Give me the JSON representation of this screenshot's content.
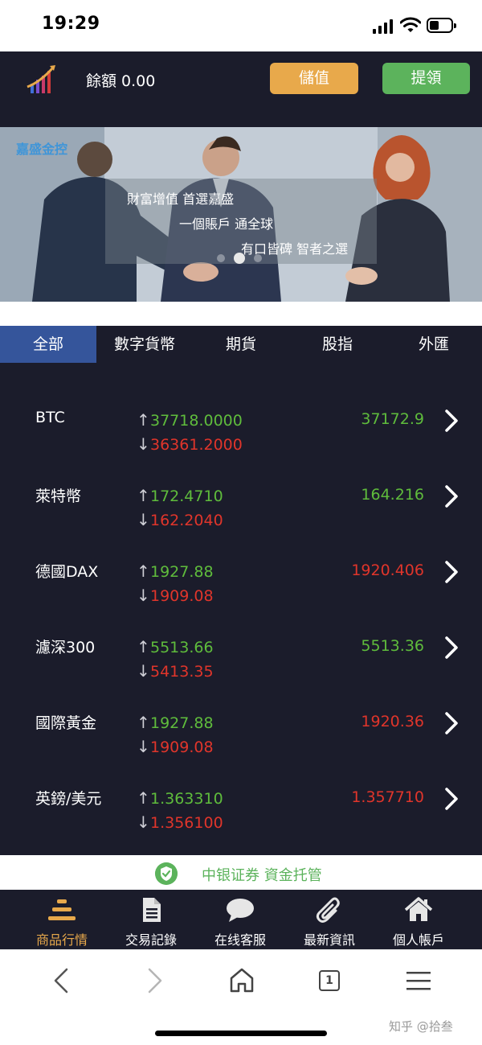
{
  "status_bar": {
    "time": "19:29"
  },
  "header": {
    "balance_label": "餘額 0.00",
    "deposit_label": "儲值",
    "withdraw_label": "提領",
    "colors": {
      "deposit": "#e8a94b",
      "withdraw": "#5cb35c",
      "background": "#1b1c2b"
    }
  },
  "banner": {
    "brand": "嘉盛金控",
    "line1": "財富增值 首選嘉盛",
    "line2": "一個賬戶 通全球",
    "line3": "有口皆碑 智者之選"
  },
  "tabs": [
    {
      "label": "全部",
      "active": true
    },
    {
      "label": "數字貨幣",
      "active": false
    },
    {
      "label": "期貨",
      "active": false
    },
    {
      "label": "股指",
      "active": false
    },
    {
      "label": "外匯",
      "active": false
    }
  ],
  "markets": [
    {
      "name": "BTC",
      "high": "37718.0000",
      "low": "36361.2000",
      "price": "37172.9",
      "price_color": "#5fbc3c"
    },
    {
      "name": "萊特幣",
      "high": "172.4710",
      "low": "162.2040",
      "price": "164.216",
      "price_color": "#5fbc3c"
    },
    {
      "name": "德國DAX",
      "high": "1927.88",
      "low": "1909.08",
      "price": "1920.406",
      "price_color": "#e0352b"
    },
    {
      "name": "濾深300",
      "high": "5513.66",
      "low": "5413.35",
      "price": "5513.36",
      "price_color": "#5fbc3c"
    },
    {
      "name": "國際黃金",
      "high": "1927.88",
      "low": "1909.08",
      "price": "1920.36",
      "price_color": "#e0352b"
    },
    {
      "name": "英鎊/美元",
      "high": "1.363310",
      "low": "1.356100",
      "price": "1.357710",
      "price_color": "#e0352b"
    }
  ],
  "arrows": {
    "up": "↑",
    "down": "↓"
  },
  "trust": {
    "text": "中银证券 資金托管",
    "icon": "shield-check-icon"
  },
  "bottom_nav": [
    {
      "label": "商品行情",
      "icon": "market-icon",
      "active": true
    },
    {
      "label": "交易記錄",
      "icon": "document-icon",
      "active": false
    },
    {
      "label": "在线客服",
      "icon": "chat-icon",
      "active": false
    },
    {
      "label": "最新資訊",
      "icon": "paperclip-icon",
      "active": false
    },
    {
      "label": "個人帳戶",
      "icon": "home-icon",
      "active": false
    }
  ],
  "browser": {
    "tab_count": "1",
    "watermark": "知乎 @拾叁"
  }
}
